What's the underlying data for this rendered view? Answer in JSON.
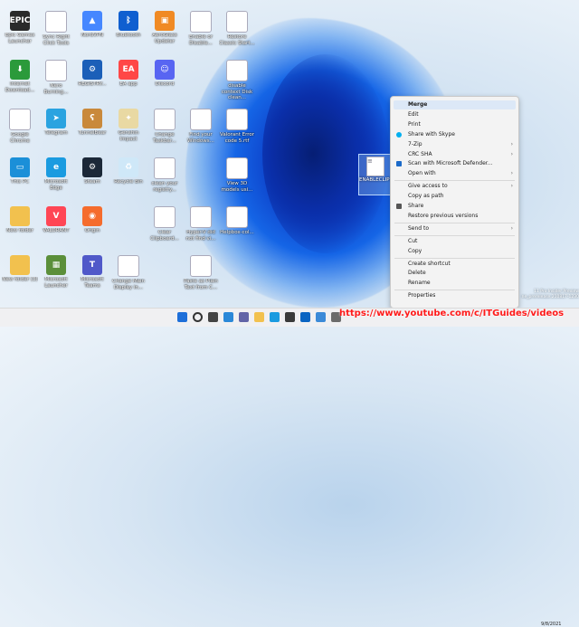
{
  "desktop_icons": [
    {
      "label": "Epic Games Launcher",
      "color": "#2a2a2a",
      "glyph": "EPIC"
    },
    {
      "label": "Sync Right Click Tools",
      "color": "#ffffff",
      "glyph": "◉"
    },
    {
      "label": "NordVPN",
      "color": "#4687ff",
      "glyph": "▲"
    },
    {
      "label": "Bluetooth",
      "color": "#0f5fd0",
      "glyph": "ᛒ"
    },
    {
      "label": "AeroGlass Updater",
      "color": "#f08a24",
      "glyph": "▣"
    },
    {
      "label": "Enable or Disable...",
      "color": "#ffffff",
      "glyph": "≡"
    },
    {
      "label": "Restore Classic Start...",
      "color": "#ffffff",
      "glyph": "≡"
    },
    {
      "label": "Internet Download...",
      "color": "#2b9a3b",
      "glyph": "⬇"
    },
    {
      "label": "Nero Burning...",
      "color": "#ffffff",
      "glyph": "◉"
    },
    {
      "label": "REGISTRY...",
      "color": "#1b5fb8",
      "glyph": "⚙"
    },
    {
      "label": "EA app",
      "color": "#ff4747",
      "glyph": "EA"
    },
    {
      "label": "Discord",
      "color": "#5865f2",
      "glyph": "☺"
    },
    {
      "label": "disable context Disk clean...",
      "color": "#ffffff",
      "glyph": "≡"
    },
    {
      "label": "Google Chrome",
      "color": "#ffffff",
      "glyph": "◍"
    },
    {
      "label": "Telegram",
      "color": "#2aa3e0",
      "glyph": "➤"
    },
    {
      "label": "TunnelBear",
      "color": "#c9893b",
      "glyph": "ʕ"
    },
    {
      "label": "Genshin Impact",
      "color": "#e9d9a3",
      "glyph": "✦"
    },
    {
      "label": "Change Taskbar...",
      "color": "#ffffff",
      "glyph": "≡"
    },
    {
      "label": "Find your Windows...",
      "color": "#ffffff",
      "glyph": "≡"
    },
    {
      "label": "Valorant Error code 5.rtf",
      "color": "#ffffff",
      "glyph": "≡"
    },
    {
      "label": "This PC",
      "color": "#1b8fd8",
      "glyph": "▭"
    },
    {
      "label": "Microsoft Edge",
      "color": "#1a9be0",
      "glyph": "e"
    },
    {
      "label": "Steam",
      "color": "#1b2838",
      "glyph": "⚙"
    },
    {
      "label": "Recycle Bin",
      "color": "#cfe8f8",
      "glyph": "♻"
    },
    {
      "label": "clean your registry...",
      "color": "#ffffff",
      "glyph": "≡"
    },
    {
      "label": "View 3D models usi...",
      "color": "#ffffff",
      "glyph": "≡"
    },
    {
      "label": "New folder",
      "color": "#f2c14e",
      "glyph": ""
    },
    {
      "label": "VALORANT",
      "color": "#ff4655",
      "glyph": "V"
    },
    {
      "label": "Origin",
      "color": "#f56c2d",
      "glyph": "◉"
    },
    {
      "label": "Clear Clipboard...",
      "color": "#ffffff",
      "glyph": "≡"
    },
    {
      "label": "Hyper-V did not find vi...",
      "color": "#ffffff",
      "glyph": "≡"
    },
    {
      "label": "Helpbox-col...",
      "color": "#ffffff",
      "glyph": "▦"
    },
    {
      "label": "New folder (3)",
      "color": "#f2c14e",
      "glyph": ""
    },
    {
      "label": "Microsoft Launcher",
      "color": "#5b8f3a",
      "glyph": "▦"
    },
    {
      "label": "Microsoft Teams",
      "color": "#5059c9",
      "glyph": "T"
    },
    {
      "label": "Change Main Display in...",
      "color": "#ffffff",
      "glyph": "≡"
    },
    {
      "label": "Paste as Plain Text from C...",
      "color": "#ffffff",
      "glyph": "≡"
    }
  ],
  "selected_file": {
    "label": "ENABLECLIPH...REG"
  },
  "context_menu": {
    "items": [
      {
        "label": "Merge",
        "highlight": true,
        "arrow": false,
        "icon": ""
      },
      {
        "label": "Edit",
        "arrow": false,
        "icon": ""
      },
      {
        "label": "Print",
        "arrow": false,
        "icon": ""
      },
      {
        "label": "Share with Skype",
        "arrow": false,
        "icon": "skype-icon"
      },
      {
        "label": "7-Zip",
        "arrow": true,
        "icon": ""
      },
      {
        "label": "CRC SHA",
        "arrow": true,
        "icon": ""
      },
      {
        "label": "Scan with Microsoft Defender...",
        "arrow": false,
        "icon": "defender-icon"
      },
      {
        "label": "Open with",
        "arrow": true,
        "icon": ""
      },
      {
        "label": "Give access to",
        "arrow": true,
        "icon": "",
        "sep_before": true
      },
      {
        "label": "Copy as path",
        "arrow": false,
        "icon": ""
      },
      {
        "label": "Share",
        "arrow": false,
        "icon": "share-icon"
      },
      {
        "label": "Restore previous versions",
        "arrow": false,
        "icon": ""
      },
      {
        "label": "Send to",
        "arrow": true,
        "icon": "",
        "sep_before": true
      },
      {
        "label": "Cut",
        "arrow": false,
        "icon": "",
        "sep_before": true
      },
      {
        "label": "Copy",
        "arrow": false,
        "icon": ""
      },
      {
        "label": "Create shortcut",
        "arrow": false,
        "icon": "",
        "sep_before": true
      },
      {
        "label": "Delete",
        "arrow": false,
        "icon": ""
      },
      {
        "label": "Rename",
        "arrow": false,
        "icon": ""
      },
      {
        "label": "Properties",
        "arrow": false,
        "icon": "",
        "sep_before": true
      }
    ]
  },
  "watermark": "https://www.youtube.com/c/ITGuides/videos",
  "insider": {
    "line1": "11 Pro Insider Preview",
    "line2": "ne_prerelease.210817-1230"
  },
  "clock": {
    "date": "9/8/2021"
  },
  "taskbar": {
    "icons": [
      "windows-icon",
      "search-icon",
      "task-view-icon",
      "widgets-icon",
      "chat-icon",
      "explorer-icon",
      "edge-icon",
      "store-icon",
      "mail-icon",
      "photos-icon",
      "settings-icon"
    ]
  },
  "colors": {
    "accent": "#0c3bc4",
    "watermark": "#ff1a1a"
  }
}
